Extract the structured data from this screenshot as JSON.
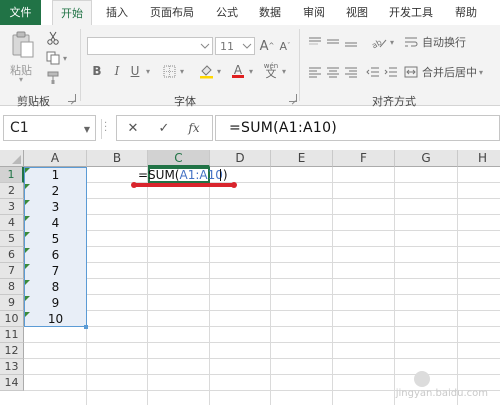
{
  "ribbon_tabs": [
    "文件",
    "开始",
    "插入",
    "页面布局",
    "公式",
    "数据",
    "审阅",
    "视图",
    "开发工具",
    "帮助"
  ],
  "clipboard": {
    "paste_label": "粘贴",
    "group_label": "剪贴板"
  },
  "font": {
    "font_size": "11",
    "group_label": "字体",
    "grow_label": "A",
    "shrink_label": "A",
    "bold": "B",
    "italic": "I",
    "underline": "U",
    "font_color_label": "A",
    "phonetic": "wén"
  },
  "alignment": {
    "wrap_text": "自动换行",
    "merge_center": "合并后居中",
    "group_label": "对齐方式"
  },
  "formula_bar": {
    "name_box": "C1",
    "cancel": "✕",
    "enter": "✓",
    "fx": "fx",
    "formula": "=SUM(A1:A10)"
  },
  "columns": [
    "A",
    "B",
    "C",
    "D",
    "E",
    "F",
    "G",
    "H"
  ],
  "rows": [
    "1",
    "2",
    "3",
    "4",
    "5",
    "6",
    "7",
    "8",
    "9",
    "10",
    "11",
    "12",
    "13",
    "14"
  ],
  "column_a_values": [
    "1",
    "2",
    "3",
    "4",
    "5",
    "6",
    "7",
    "8",
    "9",
    "10"
  ],
  "cell_c1_edit": {
    "prefix": "=SUM(",
    "range": "A1:A10",
    "suffix": ")"
  },
  "watermark": "jingyan.baidu.com",
  "colors": {
    "accent": "#217346",
    "selection_border": "#5b9bd5",
    "selection_fill": "#e8eef7",
    "annotation": "#d9252d",
    "reference_blue": "#4472c4"
  }
}
